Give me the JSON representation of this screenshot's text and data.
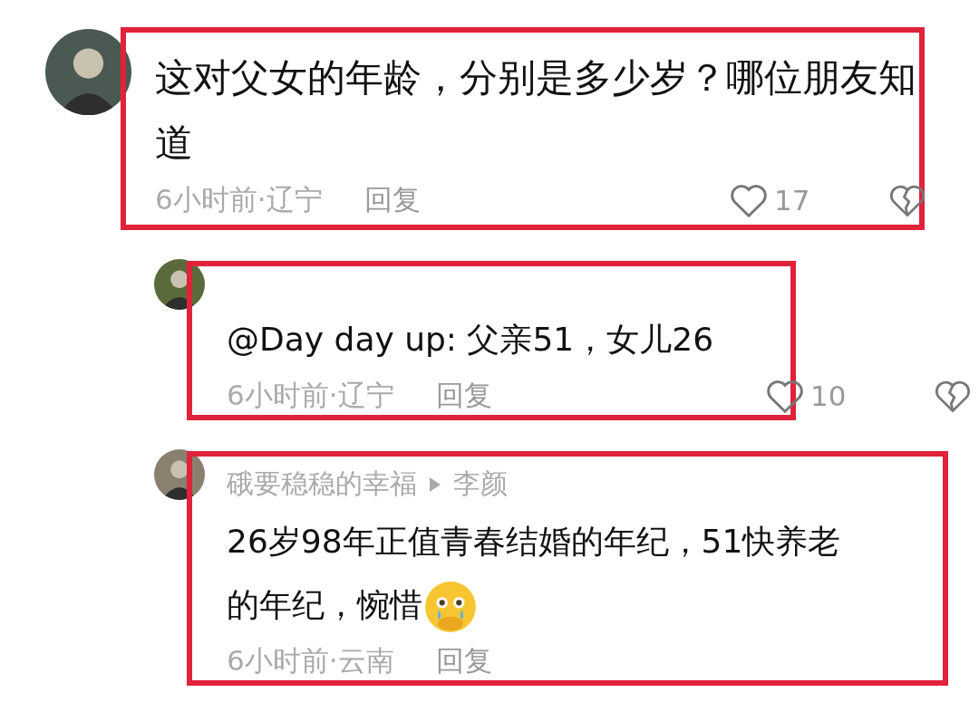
{
  "comments": [
    {
      "kind": "top",
      "highlighted": true,
      "text": "这对父女的年龄，分别是多少岁？哪位朋友知道",
      "time": "6小时前·辽宁",
      "reply": "回复",
      "likes": "17"
    },
    {
      "kind": "reply",
      "highlighted": true,
      "text": "@Day day up: 父亲51，女儿26",
      "time": "6小时前·辽宁",
      "reply": "回复",
      "likes": "10"
    },
    {
      "kind": "reply",
      "username": "硪要稳稳的幸福",
      "reply_to": "李颜",
      "highlighted": true,
      "text": "26岁98年正值青春结婚的年纪，51快养老的年纪，惋惜",
      "emoji": true,
      "time": "6小时前·云南",
      "reply": "回复"
    }
  ]
}
